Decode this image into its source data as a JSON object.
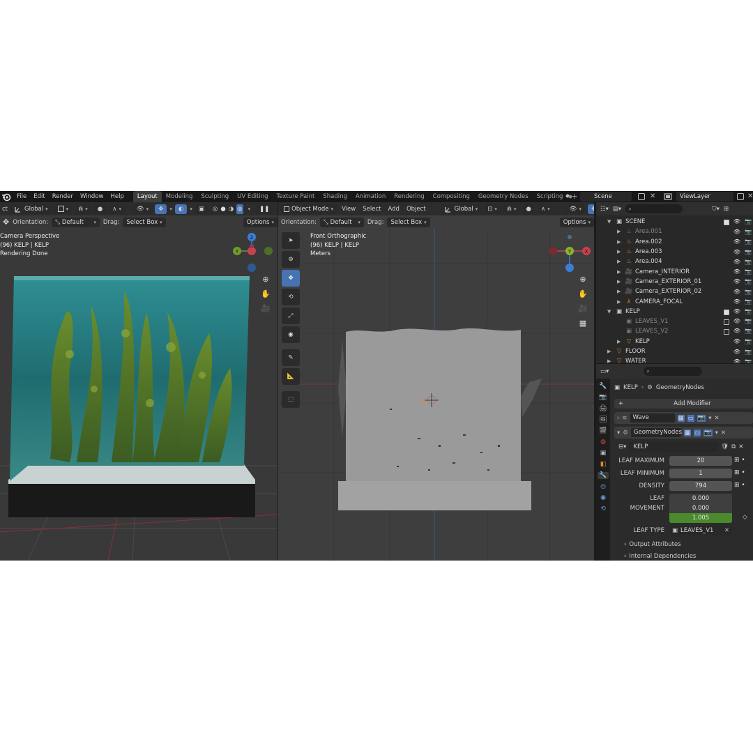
{
  "topbar": {
    "menu": [
      "File",
      "Edit",
      "Render",
      "Window",
      "Help"
    ],
    "workspaces": [
      "Layout",
      "Modeling",
      "Sculpting",
      "UV Editing",
      "Texture Paint",
      "Shading",
      "Animation",
      "Rendering",
      "Compositing",
      "Geometry Nodes",
      "Scripting"
    ],
    "active_workspace": "Layout",
    "add_tab": "+",
    "scene": "Scene",
    "view_layer": "ViewLayer"
  },
  "left_viewport": {
    "header_partial": "ct",
    "transform_orientation": "Global",
    "orientation_label": "Orientation:",
    "orientation_value": "Default",
    "drag_label": "Drag:",
    "drag_value": "Select Box",
    "options": "Options",
    "overlay_lines": [
      "Camera Perspective",
      "(96) KELP | KELP",
      "Rendering Done"
    ]
  },
  "right_viewport": {
    "mode": "Object Mode",
    "menus": [
      "View",
      "Select",
      "Add",
      "Object"
    ],
    "transform_orientation": "Global",
    "orientation_label": "Orientation:",
    "orientation_value": "Default",
    "drag_label": "Drag:",
    "drag_value": "Select Box",
    "options": "Options",
    "overlay_lines": [
      "Front Orthographic",
      "(96) KELP | KELP",
      "Meters"
    ]
  },
  "gizmo_labels": {
    "x": "X",
    "y": "Y",
    "z": "Z"
  },
  "outliner": {
    "rows": [
      {
        "name": "SCENE",
        "kind": "collection",
        "dim": false
      },
      {
        "name": "Area.001",
        "kind": "light",
        "dim": true
      },
      {
        "name": "Area.002",
        "kind": "light",
        "dim": false
      },
      {
        "name": "Area.003",
        "kind": "light",
        "dim": false
      },
      {
        "name": "Area.004",
        "kind": "light",
        "dim": false
      },
      {
        "name": "Camera_INTERIOR",
        "kind": "camera",
        "dim": false
      },
      {
        "name": "Camera_EXTERIOR_01",
        "kind": "camera",
        "dim": false
      },
      {
        "name": "Camera_EXTERIOR_02",
        "kind": "camera",
        "dim": false
      },
      {
        "name": "CAMERA_FOCAL",
        "kind": "empty",
        "dim": false
      },
      {
        "name": "KELP",
        "kind": "collection",
        "dim": false
      },
      {
        "name": "LEAVES_V1",
        "kind": "collection",
        "dim": true
      },
      {
        "name": "LEAVES_V2",
        "kind": "collection",
        "dim": true
      },
      {
        "name": "KELP",
        "kind": "mesh",
        "dim": false
      },
      {
        "name": "FLOOR",
        "kind": "mesh",
        "dim": false
      },
      {
        "name": "WATER",
        "kind": "mesh",
        "dim": false
      }
    ]
  },
  "properties": {
    "breadcrumb_object": "KELP",
    "breadcrumb_modifier": "GeometryNodes",
    "add_modifier": "Add Modifier",
    "modifiers": [
      {
        "name": "Wave"
      },
      {
        "name": "GeometryNodes"
      }
    ],
    "node_group": "KELP",
    "inputs": [
      {
        "label": "LEAF MAXIMUM",
        "value": "20"
      },
      {
        "label": "LEAF MINIMUM",
        "value": "1"
      },
      {
        "label": "DENSITY",
        "value": "794"
      }
    ],
    "leaf_movement_label": "LEAF MOVEMENT",
    "leaf_movement": [
      "0.000",
      "0.000",
      "1.005"
    ],
    "leaf_type_label": "LEAF TYPE",
    "leaf_type_value": "LEAVES_V1",
    "panels": [
      "Output Attributes",
      "Internal Dependencies"
    ]
  },
  "colors": {
    "accent": "#4772b3",
    "selection": "#334d80",
    "green_field": "#4a8a2c",
    "gizmo_x": "#c9414d",
    "gizmo_y": "#6e9d2a",
    "gizmo_z": "#3b7fd4"
  }
}
